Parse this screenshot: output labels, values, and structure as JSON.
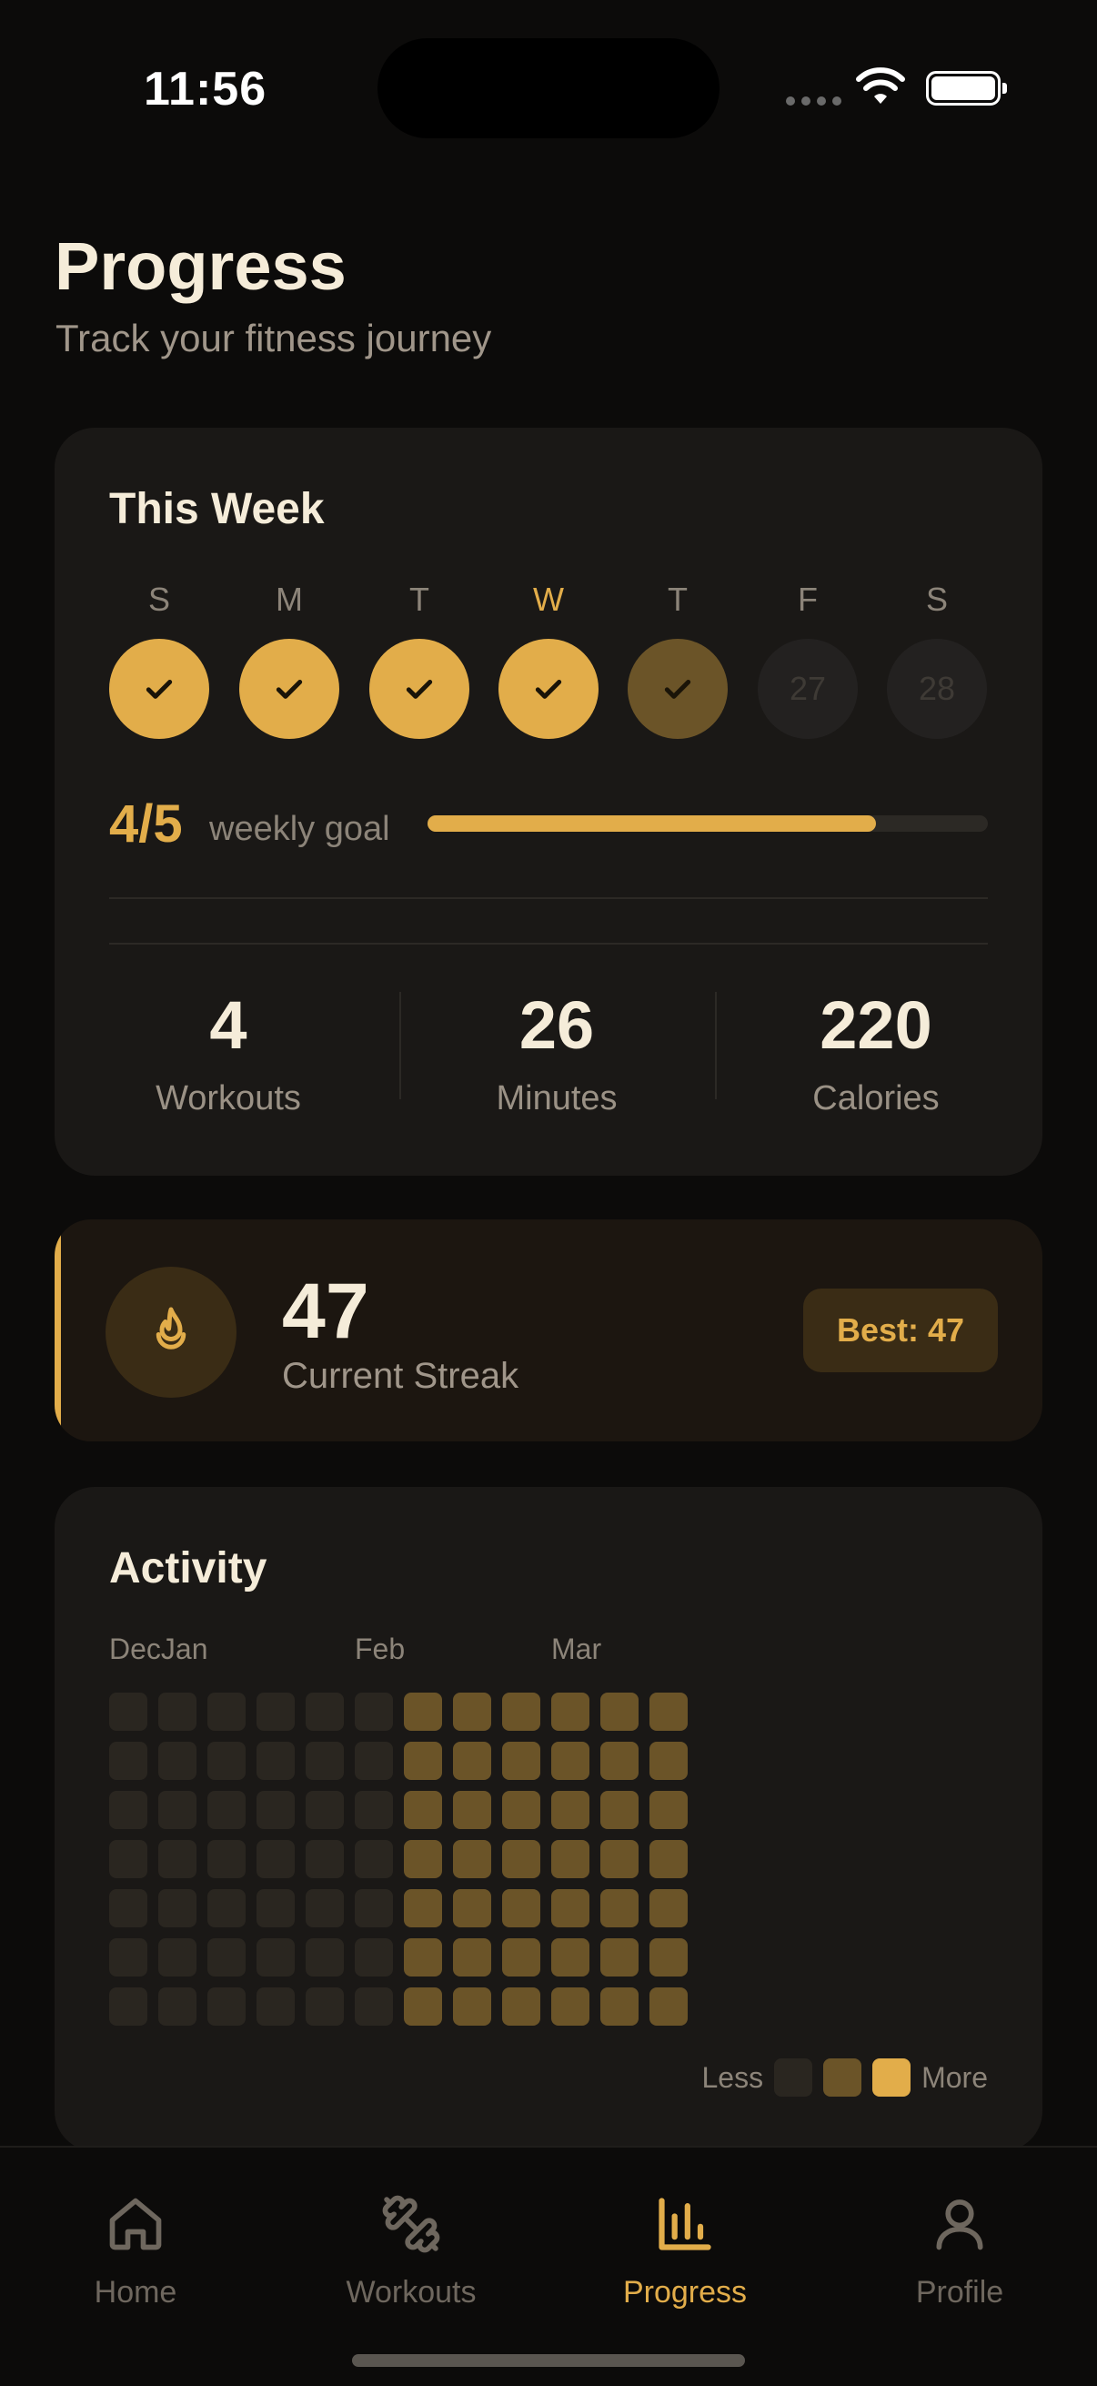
{
  "status_bar": {
    "time": "11:56"
  },
  "header": {
    "title": "Progress",
    "subtitle": "Track your fitness journey"
  },
  "week": {
    "title": "This Week",
    "days": [
      {
        "label": "S",
        "state": "done",
        "date": ""
      },
      {
        "label": "M",
        "state": "done",
        "date": ""
      },
      {
        "label": "T",
        "state": "done",
        "date": ""
      },
      {
        "label": "W",
        "state": "done",
        "date": "",
        "today": true
      },
      {
        "label": "T",
        "state": "partial",
        "date": ""
      },
      {
        "label": "F",
        "state": "empty",
        "date": "27"
      },
      {
        "label": "S",
        "state": "empty",
        "date": "28"
      }
    ],
    "goal": {
      "count": "4/5",
      "label": "weekly goal",
      "progress": 0.8
    },
    "stats": [
      {
        "value": "4",
        "label": "Workouts"
      },
      {
        "value": "26",
        "label": "Minutes"
      },
      {
        "value": "220",
        "label": "Calories"
      }
    ]
  },
  "streak": {
    "value": "47",
    "label": "Current Streak",
    "best": "Best: 47"
  },
  "activity": {
    "title": "Activity",
    "months": [
      "DecJan",
      "Feb",
      "Mar"
    ],
    "weeks": 12,
    "days_per_week": 7,
    "column_levels": [
      0,
      0,
      0,
      0,
      0,
      0,
      1,
      1,
      1,
      1,
      1,
      1
    ],
    "legend": {
      "less": "Less",
      "more": "More"
    }
  },
  "tabs": [
    {
      "label": "Home",
      "icon": "home-icon",
      "active": false
    },
    {
      "label": "Workouts",
      "icon": "dumbbell-icon",
      "active": false
    },
    {
      "label": "Progress",
      "icon": "bar-chart-icon",
      "active": true
    },
    {
      "label": "Profile",
      "icon": "person-icon",
      "active": false
    }
  ],
  "colors": {
    "accent": "#e2ad4a",
    "accent_dim": "#6b5428",
    "card": "#1a1816",
    "background": "#0c0b0a"
  }
}
